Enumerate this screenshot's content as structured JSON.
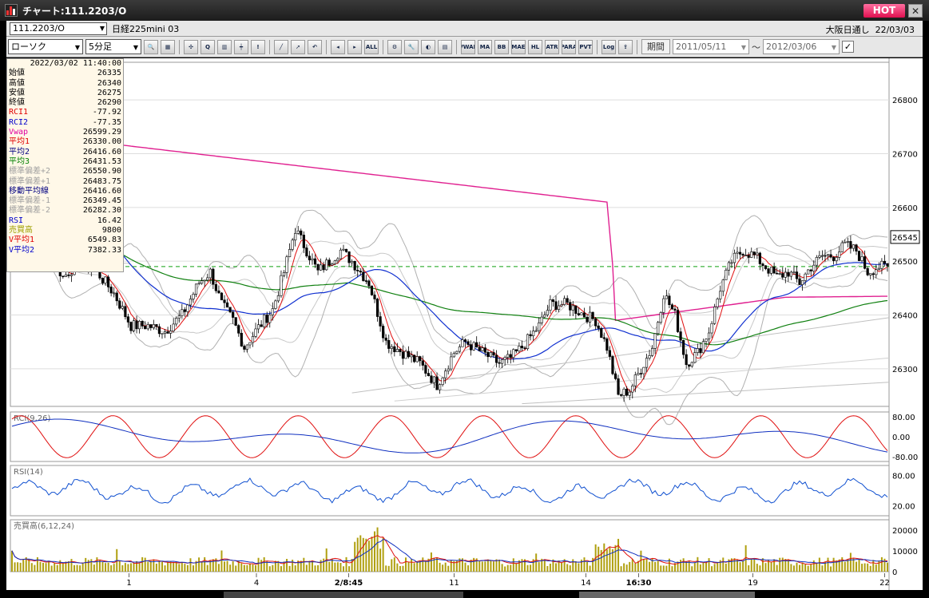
{
  "window": {
    "title": "チャート:111.2203/O",
    "hot_label": "HOT",
    "close_label": "✕"
  },
  "infobar": {
    "symbol_code": "111.2203/O",
    "symbol_name": "日経225mini 03",
    "exchange": "大阪日通し",
    "date": "22/03/03"
  },
  "toolbar": {
    "chart_type": "ローソク",
    "interval": "5分足",
    "buttons": [
      {
        "name": "zoom-button",
        "icon": "magnifier-icon",
        "label": "🔍"
      },
      {
        "name": "grid-button",
        "icon": "grid-icon",
        "label": "▦"
      },
      {
        "name": "crosshair-button",
        "icon": "crosshair-icon",
        "label": "✣"
      },
      {
        "name": "search-button",
        "icon": "search-icon",
        "label": "Q"
      },
      {
        "name": "bar-chart-button",
        "icon": "bar-chart-icon",
        "label": "▥"
      },
      {
        "name": "candle-button",
        "icon": "candle-icon",
        "label": "┿"
      },
      {
        "name": "alert-button",
        "icon": "alert-icon",
        "label": "!"
      },
      {
        "name": "draw-line-button",
        "icon": "pen-icon",
        "label": "╱"
      },
      {
        "name": "pointer-button",
        "icon": "pointer-icon",
        "label": "➚"
      },
      {
        "name": "undo-button",
        "icon": "undo-icon",
        "label": "↶"
      },
      {
        "name": "candle-left-button",
        "icon": "candle-left-icon",
        "label": "◂"
      },
      {
        "name": "candle-right-button",
        "icon": "candle-right-icon",
        "label": "▸"
      },
      {
        "name": "all-button",
        "icon": "all-icon",
        "label": "ALL"
      },
      {
        "name": "settings-button",
        "icon": "gear-icon",
        "label": "⚙"
      },
      {
        "name": "tool-button",
        "icon": "wrench-icon",
        "label": "🔧"
      },
      {
        "name": "palette-button",
        "icon": "palette-icon",
        "label": "◐"
      },
      {
        "name": "layout-button",
        "icon": "layout-icon",
        "label": "▤"
      },
      {
        "name": "vwap-button",
        "icon": "vwap-icon",
        "label": "VWAP"
      },
      {
        "name": "ma-button",
        "icon": "ma-icon",
        "label": "MA"
      },
      {
        "name": "bb-button",
        "icon": "bb-icon",
        "label": "BB"
      },
      {
        "name": "mae-button",
        "icon": "mae-icon",
        "label": "MAE"
      },
      {
        "name": "hl-button",
        "icon": "hl-icon",
        "label": "HL"
      },
      {
        "name": "atr-button",
        "icon": "atr-icon",
        "label": "ATR"
      },
      {
        "name": "parabolic-button",
        "icon": "parabolic-icon",
        "label": "PARA"
      },
      {
        "name": "pvt-button",
        "icon": "pvt-icon",
        "label": "PVT"
      },
      {
        "name": "log-button",
        "icon": "log-icon",
        "label": "Log"
      },
      {
        "name": "export-button",
        "icon": "export-icon",
        "label": "⇪"
      }
    ],
    "period_label": "期間",
    "date_from": "2011/05/11",
    "date_to": "2012/03/06",
    "tilde": "〜",
    "check": "✓"
  },
  "data_window": {
    "timestamp": "2022/03/02  11:40:00",
    "rows": [
      {
        "label": "始値",
        "value": "26335",
        "color": "#000000"
      },
      {
        "label": "高値",
        "value": "26340",
        "color": "#000000"
      },
      {
        "label": "安値",
        "value": "26275",
        "color": "#000000"
      },
      {
        "label": "終値",
        "value": "26290",
        "color": "#000000"
      },
      {
        "label": "RCI1",
        "value": "-77.92",
        "color": "#e00000"
      },
      {
        "label": "RCI2",
        "value": "-77.35",
        "color": "#0000cc"
      },
      {
        "label": "Vwap",
        "value": "26599.29",
        "color": "#e000a0"
      },
      {
        "label": "平均1",
        "value": "26330.00",
        "color": "#e00000"
      },
      {
        "label": "平均2",
        "value": "26416.60",
        "color": "#000080"
      },
      {
        "label": "平均3",
        "value": "26431.53",
        "color": "#008000"
      },
      {
        "label": "標準偏差+2",
        "value": "26550.90",
        "color": "#a0a0a0"
      },
      {
        "label": "標準偏差+1",
        "value": "26483.75",
        "color": "#a0a0a0"
      },
      {
        "label": "移動平均線",
        "value": "26416.60",
        "color": "#000080"
      },
      {
        "label": "標準偏差-1",
        "value": "26349.45",
        "color": "#a0a0a0"
      },
      {
        "label": "標準偏差-2",
        "value": "26282.30",
        "color": "#a0a0a0"
      },
      {
        "label": "RSI",
        "value": "16.42",
        "color": "#0000cc"
      },
      {
        "label": "売買高",
        "value": "9800",
        "color": "#a0a000"
      },
      {
        "label": "V平均1",
        "value": "6549.83",
        "color": "#e00000"
      },
      {
        "label": "V平均2",
        "value": "7382.33",
        "color": "#0000cc"
      }
    ]
  },
  "main_chart": {
    "y_ticks": [
      "26800",
      "26700",
      "26600",
      "26500",
      "26400",
      "26300"
    ],
    "current_price": "26545"
  },
  "rci_panel": {
    "title": "RCI(9,26)",
    "y_ticks": [
      "80.00",
      "0.00",
      "-80.00"
    ]
  },
  "rsi_panel": {
    "title": "RSI(14)",
    "y_ticks": [
      "80.00",
      "20.00"
    ]
  },
  "volume_panel": {
    "title": "売買高(6,12,24)",
    "y_ticks": [
      "20000",
      "10000",
      "0"
    ]
  },
  "x_labels": [
    {
      "text": "1",
      "bold": false
    },
    {
      "text": "4",
      "bold": false
    },
    {
      "text": "2/8:45",
      "bold": true
    },
    {
      "text": "11",
      "bold": false
    },
    {
      "text": "14",
      "bold": false
    },
    {
      "text": "16:30",
      "bold": true
    },
    {
      "text": "19",
      "bold": false
    },
    {
      "text": "22",
      "bold": false
    }
  ],
  "chart_data": {
    "type": "candlestick",
    "panels": [
      "price",
      "RCI(9,26)",
      "RSI(14)",
      "売買高(6,12,24)"
    ],
    "price_ylim": [
      26230,
      26870
    ],
    "anchors": [
      [
        0,
        26660
      ],
      [
        6,
        26590
      ],
      [
        12,
        26530
      ],
      [
        18,
        26470
      ],
      [
        24,
        26500
      ],
      [
        30,
        26480
      ],
      [
        36,
        26440
      ],
      [
        42,
        26380
      ],
      [
        48,
        26380
      ],
      [
        54,
        26370
      ],
      [
        60,
        26400
      ],
      [
        66,
        26460
      ],
      [
        70,
        26480
      ],
      [
        74,
        26420
      ],
      [
        78,
        26390
      ],
      [
        82,
        26340
      ],
      [
        86,
        26370
      ],
      [
        92,
        26410
      ],
      [
        96,
        26480
      ],
      [
        100,
        26560
      ],
      [
        104,
        26520
      ],
      [
        108,
        26480
      ],
      [
        112,
        26500
      ],
      [
        116,
        26520
      ],
      [
        120,
        26500
      ],
      [
        126,
        26460
      ],
      [
        132,
        26350
      ],
      [
        138,
        26330
      ],
      [
        144,
        26310
      ],
      [
        150,
        26270
      ],
      [
        156,
        26330
      ],
      [
        160,
        26350
      ],
      [
        166,
        26330
      ],
      [
        172,
        26310
      ],
      [
        176,
        26320
      ],
      [
        180,
        26340
      ],
      [
        186,
        26380
      ],
      [
        190,
        26420
      ],
      [
        196,
        26420
      ],
      [
        202,
        26400
      ],
      [
        206,
        26390
      ],
      [
        210,
        26340
      ],
      [
        214,
        26250
      ],
      [
        218,
        26260
      ],
      [
        222,
        26300
      ],
      [
        226,
        26340
      ],
      [
        230,
        26440
      ],
      [
        234,
        26400
      ],
      [
        238,
        26310
      ],
      [
        242,
        26330
      ],
      [
        246,
        26370
      ],
      [
        250,
        26450
      ],
      [
        254,
        26500
      ],
      [
        258,
        26520
      ],
      [
        262,
        26510
      ],
      [
        266,
        26490
      ],
      [
        270,
        26470
      ],
      [
        274,
        26480
      ],
      [
        278,
        26460
      ],
      [
        282,
        26490
      ],
      [
        286,
        26510
      ],
      [
        290,
        26510
      ],
      [
        294,
        26530
      ],
      [
        298,
        26520
      ],
      [
        302,
        26480
      ],
      [
        306,
        26490
      ]
    ]
  }
}
